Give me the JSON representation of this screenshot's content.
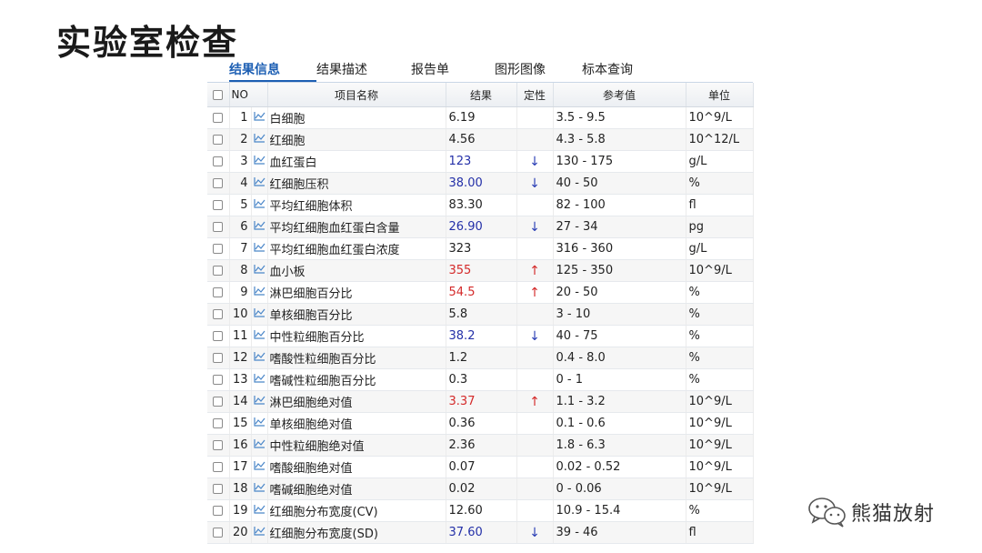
{
  "page_title": "实验室检查",
  "tabs": [
    "结果信息",
    "结果描述",
    "报告单",
    "图形图像",
    "标本查询"
  ],
  "table": {
    "headers": {
      "no": "NO",
      "name": "项目名称",
      "result": "结果",
      "qual": "定性",
      "ref": "参考值",
      "unit": "单位"
    },
    "rows": [
      {
        "no": "1",
        "name": "白细胞",
        "value": "6.19",
        "flag": "",
        "ref": "3.5 - 9.5",
        "unit": "10^9/L",
        "status": "normal"
      },
      {
        "no": "2",
        "name": "红细胞",
        "value": "4.56",
        "flag": "",
        "ref": "4.3 - 5.8",
        "unit": "10^12/L",
        "status": "normal"
      },
      {
        "no": "3",
        "name": "血红蛋白",
        "value": "123",
        "flag": "↓",
        "ref": "130 - 175",
        "unit": "g/L",
        "status": "low"
      },
      {
        "no": "4",
        "name": "红细胞压积",
        "value": "38.00",
        "flag": "↓",
        "ref": "40 - 50",
        "unit": "%",
        "status": "low"
      },
      {
        "no": "5",
        "name": "平均红细胞体积",
        "value": "83.30",
        "flag": "",
        "ref": "82 - 100",
        "unit": "fl",
        "status": "normal"
      },
      {
        "no": "6",
        "name": "平均红细胞血红蛋白含量",
        "value": "26.90",
        "flag": "↓",
        "ref": "27 - 34",
        "unit": "pg",
        "status": "low"
      },
      {
        "no": "7",
        "name": "平均红细胞血红蛋白浓度",
        "value": "323",
        "flag": "",
        "ref": "316 - 360",
        "unit": "g/L",
        "status": "normal"
      },
      {
        "no": "8",
        "name": "血小板",
        "value": "355",
        "flag": "↑",
        "ref": "125 - 350",
        "unit": "10^9/L",
        "status": "high"
      },
      {
        "no": "9",
        "name": "淋巴细胞百分比",
        "value": "54.5",
        "flag": "↑",
        "ref": "20 - 50",
        "unit": "%",
        "status": "high"
      },
      {
        "no": "10",
        "name": "单核细胞百分比",
        "value": "5.8",
        "flag": "",
        "ref": "3 - 10",
        "unit": "%",
        "status": "normal"
      },
      {
        "no": "11",
        "name": "中性粒细胞百分比",
        "value": "38.2",
        "flag": "↓",
        "ref": "40 - 75",
        "unit": "%",
        "status": "low"
      },
      {
        "no": "12",
        "name": "嗜酸性粒细胞百分比",
        "value": "1.2",
        "flag": "",
        "ref": "0.4 - 8.0",
        "unit": "%",
        "status": "normal"
      },
      {
        "no": "13",
        "name": "嗜碱性粒细胞百分比",
        "value": "0.3",
        "flag": "",
        "ref": "0 - 1",
        "unit": "%",
        "status": "normal"
      },
      {
        "no": "14",
        "name": "淋巴细胞绝对值",
        "value": "3.37",
        "flag": "↑",
        "ref": "1.1 - 3.2",
        "unit": "10^9/L",
        "status": "high"
      },
      {
        "no": "15",
        "name": "单核细胞绝对值",
        "value": "0.36",
        "flag": "",
        "ref": "0.1 - 0.6",
        "unit": "10^9/L",
        "status": "normal"
      },
      {
        "no": "16",
        "name": "中性粒细胞绝对值",
        "value": "2.36",
        "flag": "",
        "ref": "1.8 - 6.3",
        "unit": "10^9/L",
        "status": "normal"
      },
      {
        "no": "17",
        "name": "嗜酸细胞绝对值",
        "value": "0.07",
        "flag": "",
        "ref": "0.02 - 0.52",
        "unit": "10^9/L",
        "status": "normal"
      },
      {
        "no": "18",
        "name": "嗜碱细胞绝对值",
        "value": "0.02",
        "flag": "",
        "ref": "0 - 0.06",
        "unit": "10^9/L",
        "status": "normal"
      },
      {
        "no": "19",
        "name": "红细胞分布宽度(CV)",
        "value": "12.60",
        "flag": "",
        "ref": "10.9 - 15.4",
        "unit": "%",
        "status": "normal"
      },
      {
        "no": "20",
        "name": "红细胞分布宽度(SD)",
        "value": "37.60",
        "flag": "↓",
        "ref": "39 - 46",
        "unit": "fl",
        "status": "low"
      }
    ]
  },
  "watermark": {
    "text": "熊猫放射",
    "icon": "wechat-icon"
  },
  "colors": {
    "low": "#2430a8",
    "high": "#d42a2a",
    "tab_active": "#1d5fb3",
    "chart_icon": "#4a86c8"
  }
}
